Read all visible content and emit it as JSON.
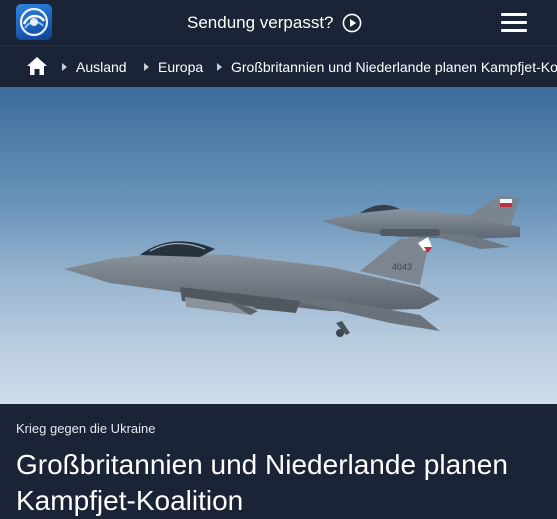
{
  "header": {
    "logo_icon": "tagesschau-logo-icon",
    "sendung_label": "Sendung verpasst?",
    "play_icon": "play-circle-icon",
    "menu_icon": "hamburger-menu-icon"
  },
  "breadcrumb": {
    "home_icon": "home-icon",
    "items": [
      {
        "label": "Ausland"
      },
      {
        "label": "Europa"
      },
      {
        "label": "Großbritannien und Niederlande planen Kampfjet-Koalition"
      }
    ]
  },
  "hero": {
    "image_subject": "two F-16 fighter jets in flight"
  },
  "article": {
    "topline": "Krieg gegen die Ukraine",
    "headline": "Großbritannien und Niederlande planen Kampfjet-Koalition"
  },
  "colors": {
    "header_bg": "#1b2336",
    "logo_blue": "#1a5cb8",
    "text": "#ffffff"
  }
}
